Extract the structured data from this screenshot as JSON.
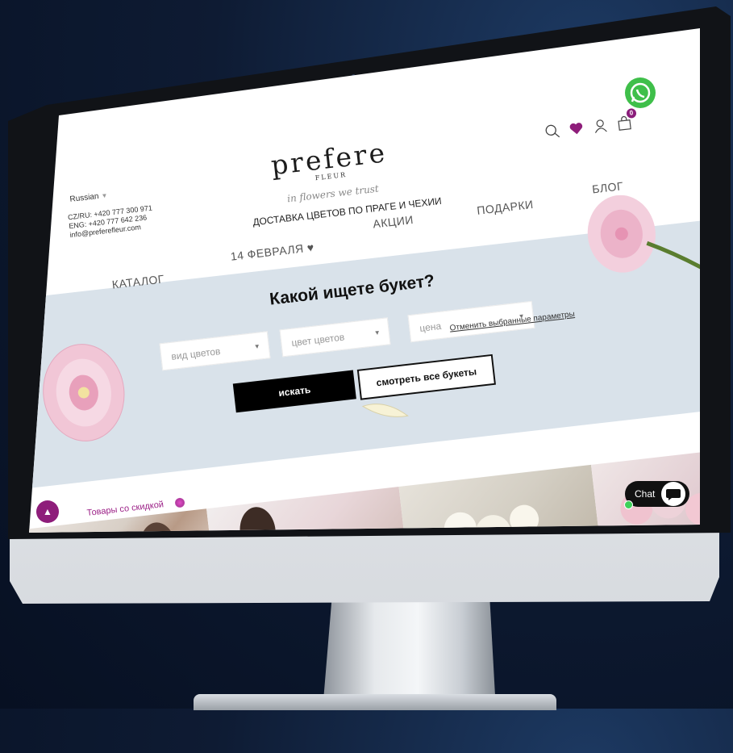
{
  "header": {
    "language": "Russian",
    "contacts": [
      "CZ/RU: +420 777 300 971",
      "ENG: +420 777 642 236",
      "info@preferefleur.com"
    ],
    "logo_word": "prefere",
    "logo_sub": "FLEUR",
    "tagline": "in flowers we trust",
    "delivery": "ДОСТАВКА ЦВЕТОВ ПО ПРАГЕ И ЧЕХИИ",
    "cart_count": "0"
  },
  "nav": {
    "catalog": "КАТАЛОГ",
    "feb14": "14 ФЕВРАЛЯ ♥",
    "promotions": "АКЦИИ",
    "gifts": "ПОДАРКИ",
    "blog": "БЛОГ"
  },
  "finder": {
    "title": "Какой ищете букет?",
    "flower_type_placeholder": "вид цветов",
    "flower_color_placeholder": "цвет цветов",
    "price_placeholder": "цена",
    "reset_link": "Отменить выбранные параметры",
    "search_button": "искать",
    "all_button": "смотреть все букеты"
  },
  "discount": {
    "label": "Товары со скидкой"
  },
  "chat": {
    "label": "Chat"
  },
  "colors": {
    "accent": "#8e1d7a",
    "band": "#d9e2ea",
    "whatsapp": "#3fbf4a"
  },
  "icons": [
    "search-icon",
    "heart-icon",
    "user-icon",
    "cart-icon",
    "whatsapp-icon",
    "chevron-up-icon",
    "chat-bubble-icon"
  ]
}
